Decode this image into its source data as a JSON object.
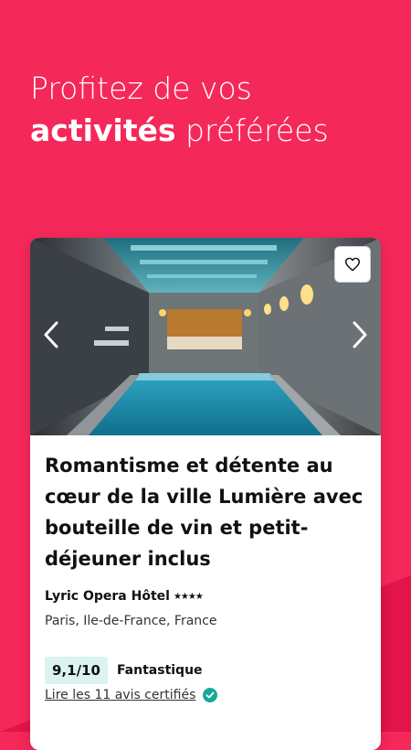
{
  "colors": {
    "background": "#f5285a",
    "accent_teal": "#1aa89c",
    "score_bg": "#dbf3f1"
  },
  "headline": {
    "line1": "Profitez de vos",
    "bold": "activités",
    "rest": " préférées"
  },
  "card": {
    "title": "Romantisme et détente au cœur de la ville Lumière avec bouteille de vin et petit-déjeuner inclus",
    "hotel_name": "Lyric Opera Hôtel",
    "stars": "★★★★",
    "location": "Paris, Ile-de-France, France",
    "score": "9,1/10",
    "rating_label": "Fantastique",
    "reviews_link": "Lire les 11 avis certifiés"
  },
  "icons": {
    "favorite": "heart-icon",
    "prev": "chevron-left-icon",
    "next": "chevron-right-icon",
    "verified": "check-circle-icon"
  }
}
